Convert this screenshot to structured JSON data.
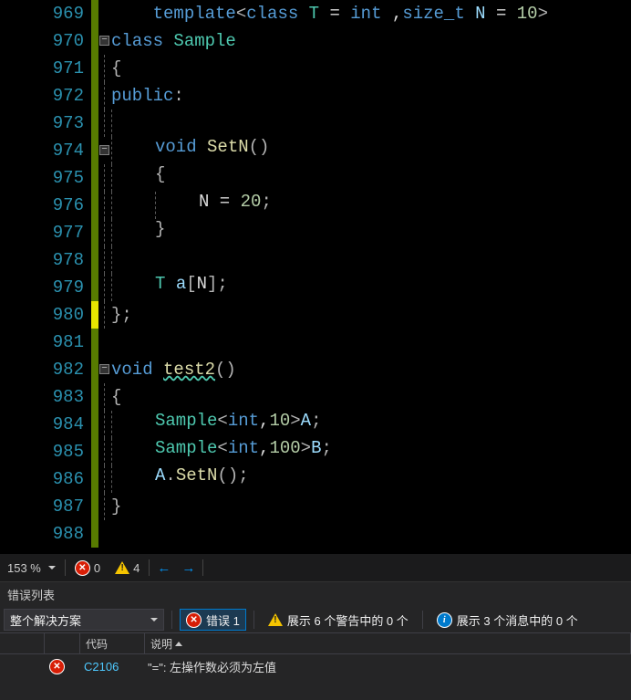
{
  "editor": {
    "lines": [
      {
        "num": "969",
        "fold": false,
        "vbar": false,
        "changed": false,
        "indent": 0,
        "tokens": [
          [
            "    ",
            "white"
          ],
          [
            "template",
            "kw"
          ],
          [
            "<",
            "punc"
          ],
          [
            "class",
            "kw"
          ],
          [
            " ",
            "white"
          ],
          [
            "T",
            "type"
          ],
          [
            " = ",
            "white"
          ],
          [
            "int",
            "kw"
          ],
          [
            " ,",
            "white"
          ],
          [
            "size_t",
            "kw"
          ],
          [
            " ",
            "white"
          ],
          [
            "N",
            "var"
          ],
          [
            " = ",
            "white"
          ],
          [
            "10",
            "num"
          ],
          [
            ">",
            "punc"
          ]
        ]
      },
      {
        "num": "970",
        "fold": true,
        "vbar": false,
        "changed": false,
        "indent": 0,
        "tokens": [
          [
            "class",
            "kw"
          ],
          [
            " ",
            "white"
          ],
          [
            "Sample",
            "type"
          ]
        ]
      },
      {
        "num": "971",
        "fold": false,
        "vbar": true,
        "changed": false,
        "indent": 0,
        "tokens": [
          [
            "{",
            "punc"
          ]
        ]
      },
      {
        "num": "972",
        "fold": false,
        "vbar": true,
        "changed": false,
        "indent": 0,
        "tokens": [
          [
            "public",
            "kw"
          ],
          [
            ":",
            "punc"
          ]
        ]
      },
      {
        "num": "973",
        "fold": false,
        "vbar": true,
        "changed": false,
        "indent": 1,
        "tokens": []
      },
      {
        "num": "974",
        "fold": true,
        "vbar": true,
        "changed": false,
        "indent": 1,
        "tokens": [
          [
            "void",
            "kw"
          ],
          [
            " ",
            "white"
          ],
          [
            "SetN",
            "func"
          ],
          [
            "()",
            "punc"
          ]
        ]
      },
      {
        "num": "975",
        "fold": false,
        "vbar": true,
        "changed": false,
        "indent": 1,
        "tokens": [
          [
            "{",
            "punc"
          ]
        ]
      },
      {
        "num": "976",
        "fold": false,
        "vbar": true,
        "changed": false,
        "indent": 2,
        "tokens": [
          [
            "N",
            "white"
          ],
          [
            " = ",
            "white"
          ],
          [
            "20",
            "num"
          ],
          [
            ";",
            "punc"
          ]
        ]
      },
      {
        "num": "977",
        "fold": false,
        "vbar": true,
        "changed": false,
        "indent": 1,
        "tokens": [
          [
            "}",
            "punc"
          ]
        ]
      },
      {
        "num": "978",
        "fold": false,
        "vbar": true,
        "changed": false,
        "indent": 1,
        "tokens": []
      },
      {
        "num": "979",
        "fold": false,
        "vbar": true,
        "changed": false,
        "indent": 1,
        "tokens": [
          [
            "T",
            "type"
          ],
          [
            " ",
            "white"
          ],
          [
            "a",
            "var"
          ],
          [
            "[",
            "punc"
          ],
          [
            "N",
            "white"
          ],
          [
            "];",
            "punc"
          ]
        ]
      },
      {
        "num": "980",
        "fold": false,
        "vbar": true,
        "changed": true,
        "indent": 0,
        "tokens": [
          [
            "};",
            "punc"
          ]
        ]
      },
      {
        "num": "981",
        "fold": false,
        "vbar": false,
        "changed": false,
        "indent": 0,
        "tokens": []
      },
      {
        "num": "982",
        "fold": true,
        "vbar": false,
        "changed": false,
        "indent": 0,
        "tokens": [
          [
            "void",
            "kw"
          ],
          [
            " ",
            "white"
          ],
          [
            "test2",
            "func",
            "squiggle"
          ],
          [
            "()",
            "punc"
          ]
        ]
      },
      {
        "num": "983",
        "fold": false,
        "vbar": true,
        "changed": false,
        "indent": 0,
        "tokens": [
          [
            "{",
            "punc"
          ]
        ]
      },
      {
        "num": "984",
        "fold": false,
        "vbar": true,
        "changed": false,
        "indent": 1,
        "tokens": [
          [
            "Sample",
            "type"
          ],
          [
            "<",
            "punc"
          ],
          [
            "int",
            "kw"
          ],
          [
            ",",
            "white"
          ],
          [
            "10",
            "num"
          ],
          [
            ">",
            "punc"
          ],
          [
            "A",
            "var"
          ],
          [
            ";",
            "punc"
          ]
        ]
      },
      {
        "num": "985",
        "fold": false,
        "vbar": true,
        "changed": false,
        "indent": 1,
        "tokens": [
          [
            "Sample",
            "type"
          ],
          [
            "<",
            "punc"
          ],
          [
            "int",
            "kw"
          ],
          [
            ",",
            "white"
          ],
          [
            "100",
            "num"
          ],
          [
            ">",
            "punc"
          ],
          [
            "B",
            "var"
          ],
          [
            ";",
            "punc"
          ]
        ]
      },
      {
        "num": "986",
        "fold": false,
        "vbar": true,
        "changed": false,
        "indent": 1,
        "tokens": [
          [
            "A",
            "var"
          ],
          [
            ".",
            "punc"
          ],
          [
            "SetN",
            "func"
          ],
          [
            "();",
            "punc"
          ]
        ]
      },
      {
        "num": "987",
        "fold": false,
        "vbar": true,
        "changed": false,
        "indent": 0,
        "tokens": [
          [
            "}",
            "punc"
          ]
        ]
      },
      {
        "num": "988",
        "fold": false,
        "vbar": false,
        "changed": false,
        "indent": 0,
        "tokens": []
      }
    ]
  },
  "status": {
    "zoom": "153 %",
    "errors": "0",
    "warnings": "4"
  },
  "errorList": {
    "title": "错误列表",
    "scope": "整个解决方案",
    "errFilter": "错误 1",
    "warnFilter": "展示 6 个警告中的 0 个",
    "infoFilter": "展示 3 个消息中的 0 个",
    "columns": {
      "icon": "",
      "code": "代码",
      "desc": "说明"
    },
    "rows": [
      {
        "code": "C2106",
        "desc": "\"=\": 左操作数必须为左值"
      }
    ]
  }
}
